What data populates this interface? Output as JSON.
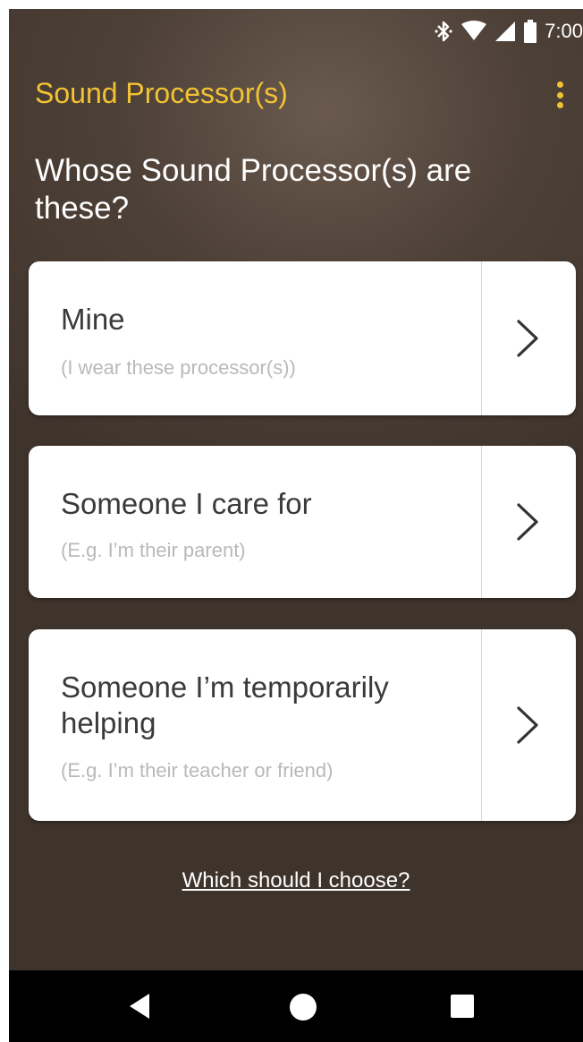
{
  "status_bar": {
    "time": "7:00",
    "icons": [
      "bluetooth-icon",
      "wifi-icon",
      "cellular-signal-icon",
      "battery-icon"
    ]
  },
  "app_bar": {
    "title": "Sound Processor(s)",
    "menu_icon": "overflow-menu-icon"
  },
  "question": "Whose Sound Processor(s) are these?",
  "options": [
    {
      "title": "Mine",
      "subtitle": "(I wear these processor(s))",
      "icon": "chevron-right-icon"
    },
    {
      "title": "Someone I care for",
      "subtitle": "(E.g. I’m their parent)",
      "icon": "chevron-right-icon"
    },
    {
      "title": "Someone I’m temporarily helping",
      "subtitle": "(E.g. I’m their teacher or friend)",
      "icon": "chevron-right-icon"
    }
  ],
  "help_link": "Which should I choose?",
  "nav_bar": [
    "back-icon",
    "home-icon",
    "recents-icon"
  ],
  "colors": {
    "accent": "#f2c233",
    "background": "#4d4037",
    "card": "#ffffff",
    "subtitle": "#b9b9b9"
  }
}
